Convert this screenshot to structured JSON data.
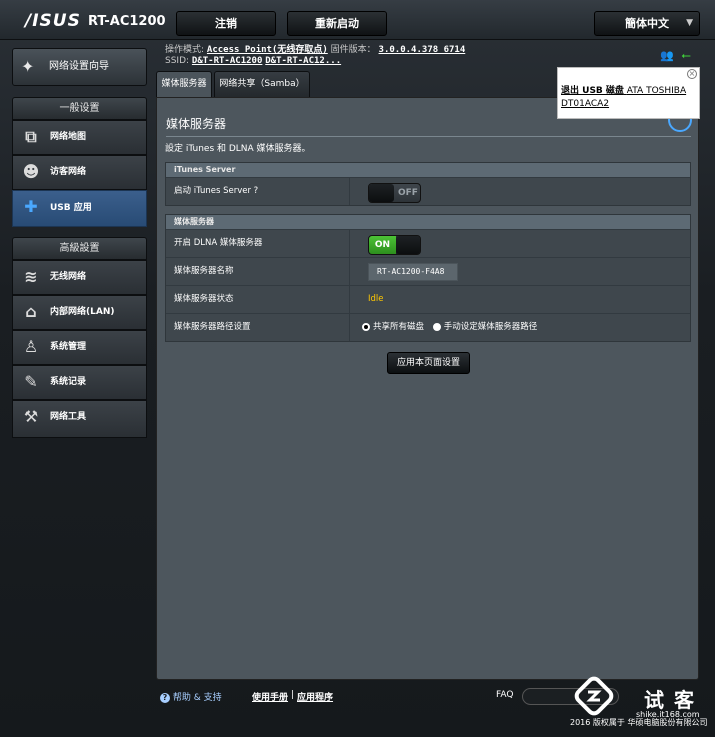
{
  "header": {
    "logo": "/ISUS",
    "model": "RT-AC1200",
    "logout_label": "注销",
    "reboot_label": "重新启动",
    "language_label": "簡体中文"
  },
  "info": {
    "mode_label": "操作模式:",
    "mode_value": "Access Point(无线存取点)",
    "firmware_label": "固件版本：",
    "firmware_value": "3.0.0.4.378_6714",
    "ssid_label": "SSID:",
    "ssid_1": "D&T-RT-AC1200",
    "ssid_2": "D&T-RT-AC12..."
  },
  "sidebar": {
    "wizard_label": "网络设置向导",
    "general_header": "一般设置",
    "advanced_header": "高級設置",
    "general_items": [
      {
        "label": "网络地图"
      },
      {
        "label": "访客网络"
      },
      {
        "label": "USB 应用"
      }
    ],
    "advanced_items": [
      {
        "label": "无线网络"
      },
      {
        "label": "内部网络(LAN)"
      },
      {
        "label": "系统管理"
      },
      {
        "label": "系统记录"
      },
      {
        "label": "网络工具"
      }
    ]
  },
  "tabs": [
    {
      "label": "媒体服务器"
    },
    {
      "label": "网络共享（Samba）"
    }
  ],
  "main": {
    "title": "媒体服务器",
    "description": "設定 iTunes 和 DLNA 媒体服务器。",
    "itunes_header": "iTunes Server",
    "itunes_label": "启动 iTunes Server ?",
    "itunes_state": "OFF",
    "media_header": "媒体服务器",
    "dlna_label": "开启 DLNA 媒体服务器",
    "dlna_state": "ON",
    "name_label": "媒体服务器名称",
    "name_value": "RT-AC1200-F4A8",
    "status_label": "媒体服务器状态",
    "status_value": "Idle",
    "path_label": "媒体服务器路径设置",
    "path_option_1": "共享所有磁盘",
    "path_option_2": "手动设定媒体服务器路径",
    "apply_label": "应用本页面设置"
  },
  "popup": {
    "eject_label": "退出 USB 磁盘",
    "device_line1": "ATA TOSHIBA",
    "device_line2": "DT01ACA2"
  },
  "footer": {
    "help_label": "帮助 & 支持",
    "manual_label": "使用手册",
    "separator": "|",
    "utility_label": "应用程序",
    "faq_label": "FAQ",
    "copyright": "2016 版权属于 华硕电脑股份有限公司"
  },
  "watermark": {
    "title": "试客",
    "url": "shike.it168.com"
  },
  "colors": {
    "accent_blue": "#2f5a8a",
    "status_yellow": "#ffc800",
    "toggle_green": "#3fae2a"
  }
}
